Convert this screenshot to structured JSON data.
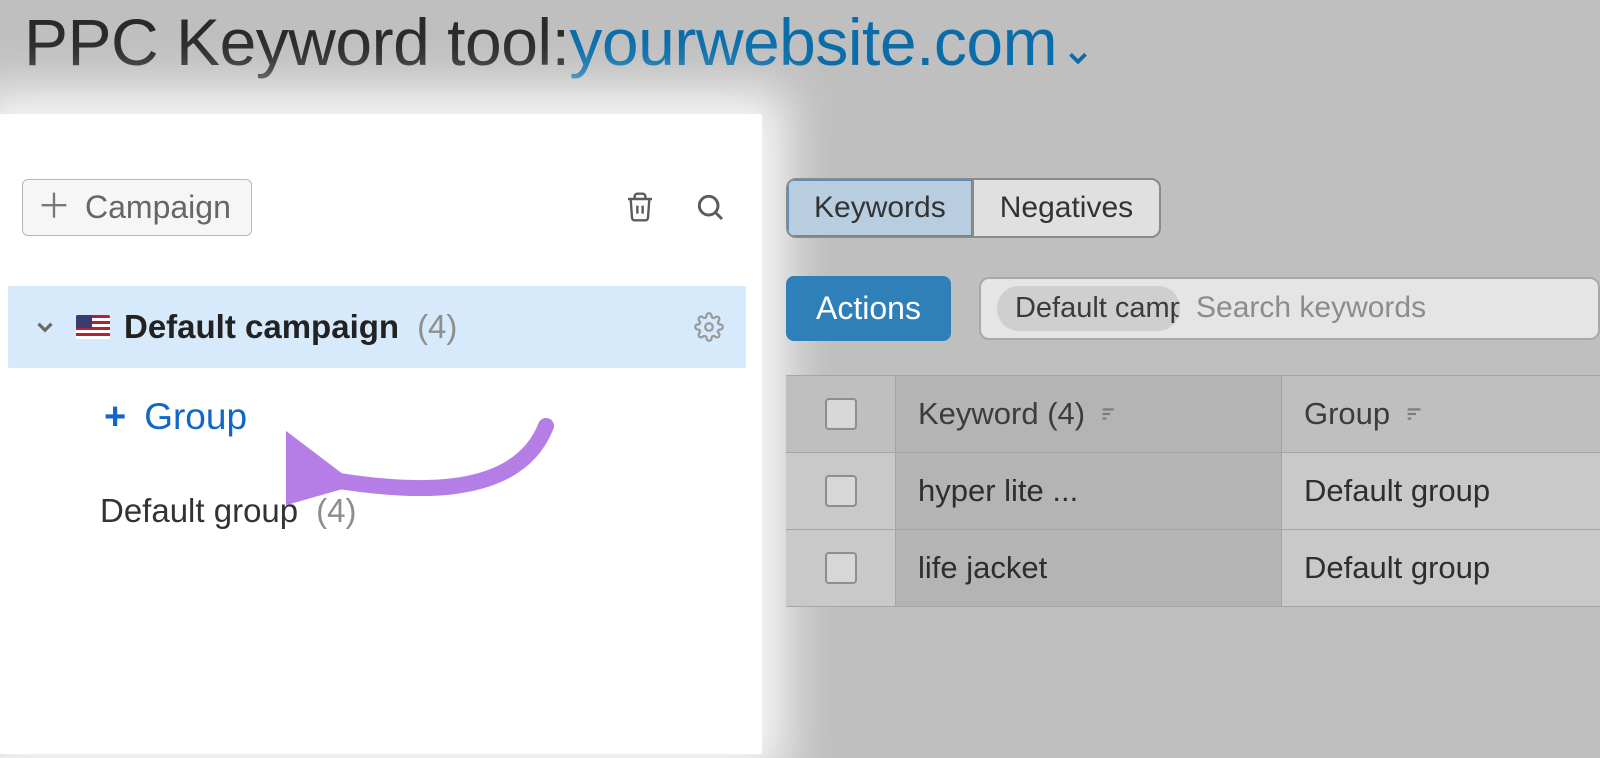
{
  "header": {
    "title_prefix": "PPC Keyword tool:",
    "site": "yourwebsite.com"
  },
  "sidebar": {
    "add_campaign_label": "Campaign",
    "campaign": {
      "name": "Default campaign",
      "count": "(4)"
    },
    "add_group_label": "Group",
    "default_group": {
      "name": "Default group",
      "count": "(4)"
    }
  },
  "tabs": {
    "keywords": "Keywords",
    "negatives": "Negatives"
  },
  "toolbar": {
    "actions_label": "Actions",
    "chip_label": "Default campa",
    "search_placeholder": "Search keywords"
  },
  "table": {
    "headers": {
      "keyword": "Keyword (4)",
      "group": "Group"
    },
    "rows": [
      {
        "keyword": "hyper lite ...",
        "group": "Default group"
      },
      {
        "keyword": "life jacket",
        "group": "Default group"
      }
    ]
  }
}
